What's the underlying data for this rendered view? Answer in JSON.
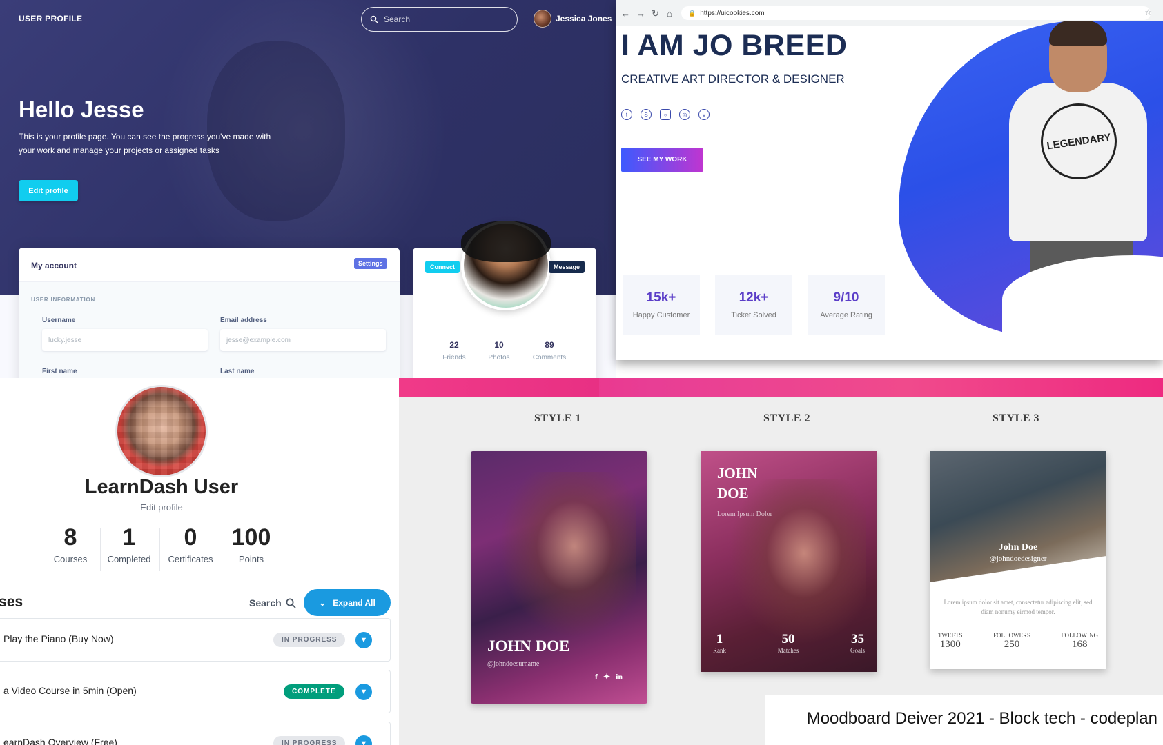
{
  "panel1": {
    "brand": "USER PROFILE",
    "search_placeholder": "Search",
    "user_name": "Jessica Jones",
    "hello": "Hello Jesse",
    "intro": "This is your profile page. You can see the progress you've made with your work and manage your projects or assigned tasks",
    "edit_button": "Edit profile",
    "account": {
      "title": "My account",
      "settings": "Settings",
      "section": "USER INFORMATION",
      "username_label": "Username",
      "username_value": "lucky.jesse",
      "email_label": "Email address",
      "email_placeholder": "jesse@example.com",
      "first_name_label": "First name",
      "last_name_label": "Last name"
    },
    "profile_card": {
      "connect": "Connect",
      "message": "Message",
      "stats": [
        {
          "value": "22",
          "label": "Friends"
        },
        {
          "value": "10",
          "label": "Photos"
        },
        {
          "value": "89",
          "label": "Comments"
        }
      ]
    }
  },
  "panel2": {
    "url": "https://uicookies.com",
    "name": "I AM JO BREED",
    "role": "CREATIVE ART DIRECTOR & DESIGNER",
    "social_icons": [
      "twitter-icon",
      "skype-icon",
      "instagram-icon",
      "dribbble-icon",
      "vimeo-icon"
    ],
    "cta": "SEE MY WORK",
    "shirt_text": "LEGENDARY",
    "stats": [
      {
        "value": "15k+",
        "label": "Happy Customer"
      },
      {
        "value": "12k+",
        "label": "Ticket Solved"
      },
      {
        "value": "9/10",
        "label": "Average Rating"
      }
    ]
  },
  "panel3": {
    "user": "LearnDash User",
    "edit": "Edit profile",
    "stats": [
      {
        "value": "8",
        "label": "Courses"
      },
      {
        "value": "1",
        "label": "Completed"
      },
      {
        "value": "0",
        "label": "Certificates"
      },
      {
        "value": "100",
        "label": "Points"
      }
    ],
    "courses_title": "rses",
    "search": "Search",
    "expand_all": "Expand All",
    "rows": [
      {
        "title": "Play the Piano (Buy Now)",
        "status": "IN PROGRESS"
      },
      {
        "title": "a Video Course in 5min (Open)",
        "status": "COMPLETE"
      },
      {
        "title": "earnDash Overview (Free)",
        "status": "IN PROGRESS"
      }
    ]
  },
  "panel4": {
    "styles": [
      "STYLE 1",
      "STYLE 2",
      "STYLE 3"
    ],
    "card1": {
      "name": "JOHN DOE",
      "handle": "@johndoesurname"
    },
    "card2": {
      "first": "JOHN",
      "last": "DOE",
      "sub": "Lorem Ipsum Dolor",
      "stats": [
        {
          "value": "1",
          "label": "Rank"
        },
        {
          "value": "50",
          "label": "Matches"
        },
        {
          "value": "35",
          "label": "Goals"
        }
      ]
    },
    "card3": {
      "name": "John Doe",
      "handle": "@johndoedesigner",
      "text": "Lorem ipsum dolor sit amet, consectetur adipiscing elit, sed diam nonumy eirmod tempor.",
      "stats": [
        {
          "label": "TWEETS",
          "value": "1300"
        },
        {
          "label": "FOLLOWERS",
          "value": "250"
        },
        {
          "label": "FOLLOWING",
          "value": "168"
        }
      ]
    },
    "caption": "Moodboard Deiver 2021 - Block tech - codeplan"
  }
}
